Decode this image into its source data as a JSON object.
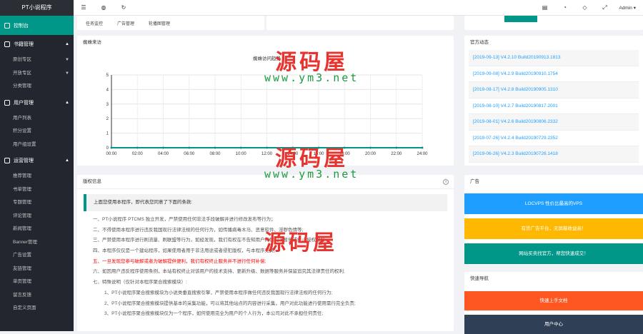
{
  "brand": "PT小说程序",
  "sidebar": {
    "dashboard": "控制台",
    "sections": [
      {
        "title": "书籍管理",
        "items": [
          {
            "label": "原创专区",
            "arrow": true
          },
          {
            "label": "开放专区",
            "arrow": true
          },
          {
            "label": "分类管理",
            "arrow": false
          }
        ]
      },
      {
        "title": "用户管理",
        "items": [
          {
            "label": "用户列表"
          },
          {
            "label": "积分设置"
          },
          {
            "label": "用户组设置"
          }
        ]
      },
      {
        "title": "运营管理",
        "items": [
          {
            "label": "推荐管理"
          },
          {
            "label": "书单管理"
          },
          {
            "label": "专题管理"
          },
          {
            "label": "评论管理"
          },
          {
            "label": "新闻管理"
          },
          {
            "label": "Banner管理"
          },
          {
            "label": "广告设置"
          },
          {
            "label": "友链管理"
          },
          {
            "label": "单页管理"
          },
          {
            "label": "留言反馈"
          },
          {
            "label": "自定义页面"
          }
        ]
      }
    ]
  },
  "topbar": {
    "user": "Admin"
  },
  "topcard": {
    "links": [
      "任务监控",
      "广告管理",
      "轮播图管理"
    ]
  },
  "chart_card": {
    "title": "蜘蛛来访"
  },
  "chart_data": {
    "type": "line",
    "title": "蜘蛛访问趋势",
    "x": [
      "00:00",
      "02:00",
      "04:00",
      "06:00",
      "08:00",
      "10:00",
      "12:00",
      "14:00",
      "16:00",
      "18:00",
      "20:00",
      "22:00",
      "24:00"
    ],
    "series": [
      {
        "values": [
          0,
          0,
          0,
          0,
          0,
          0,
          0,
          0,
          0,
          0,
          0,
          0,
          0
        ]
      }
    ],
    "ylim": [
      0,
      5
    ],
    "yticks": [
      0,
      1,
      2,
      3,
      4,
      5
    ],
    "color": "#009688"
  },
  "license": {
    "title": "版权信息",
    "quote": "上面您使用本程序，即代表您同意了下面的条款:",
    "lines": [
      {
        "text": "一、PT小说程序 PTCMS 独立开发，严禁使用任何非法手段破解并进行修改发布等行为；",
        "cls": ""
      },
      {
        "text": "二、不得使用本程序进行违反我国现行法律法规的任何行为，如传播病毒木马、恶意软件、淫秽色情等;",
        "cls": ""
      },
      {
        "text": "三、严禁使用本程序进行刷流量、刷联盟等行为，如经发现，我们有权在不告知用户的情况下暂停或终止授权服务;",
        "cls": ""
      },
      {
        "text": "四、本程序仅仅是一个建站程序，如果使用者用于非法用途或者侵犯版权，与本程序无关;",
        "cls": ""
      },
      {
        "text": "五、一旦发现您参与破解或者为破解提供便利，我们有权终止服务并不进行任何补偿;",
        "cls": "red"
      },
      {
        "text": "六、如因用户违反程序使用条例，本站有权终止对该用户的技术支持、更新升级、数据等服务并保留追究其法律责任的权利;",
        "cls": ""
      },
      {
        "text": "七、特殊说明（仅针对本程序聚合搜索模块）:",
        "cls": ""
      },
      {
        "text": "1、PT小说程序聚合搜索模块为小说类垂直搜索引擎，严禁使用本程序做任何违反我国现行法律法规的任何行为;",
        "cls": "sub2"
      },
      {
        "text": "2、PT小说程序聚合搜索模块提供基本的采集功能，可以将其他站点的内容进行采集，用户对此功能进行使用需行完全负责;",
        "cls": "sub2"
      },
      {
        "text": "3、PT小说程序聚合搜索模块仅为一个程序，如何使用完全为用户的个人行为，本公司对此不承担任何责任;",
        "cls": "sub2"
      }
    ]
  },
  "news": {
    "title": "官方动态",
    "items": [
      "[2019-09-13] V4.2.10 Build20190913.1813",
      "[2019-09-08] V4.2.9 Build20190910.1754",
      "[2019-08-17] V4.2.8 Build20190905.1310",
      "[2019-08-10] V4.2.7 Build20190817.2001",
      "[2019-08-01] V4.2.6 Build20190806.2332",
      "[2019-07-26] V4.2.4 Build20190729.2352",
      "[2019-06-26] V4.2.3 Build20190726.1418"
    ]
  },
  "ads": {
    "title": "广告",
    "items": [
      {
        "label": "LOCVPS 性价比最高的VPS",
        "color": "#1e9fff"
      },
      {
        "label": "有货广告平台，无屏蔽收益高！",
        "color": "#ffb800"
      },
      {
        "label": "网站买卖找官方，帮您快速成交！",
        "color": "#009688"
      }
    ]
  },
  "quick": {
    "title": "快速导航",
    "items": [
      {
        "label": "快速上手文档",
        "color": "#ff5722"
      },
      {
        "label": "用户中心",
        "color": "#2f4056"
      }
    ]
  },
  "watermark": {
    "a": "源码屋",
    "b": "www.ym3.net"
  }
}
